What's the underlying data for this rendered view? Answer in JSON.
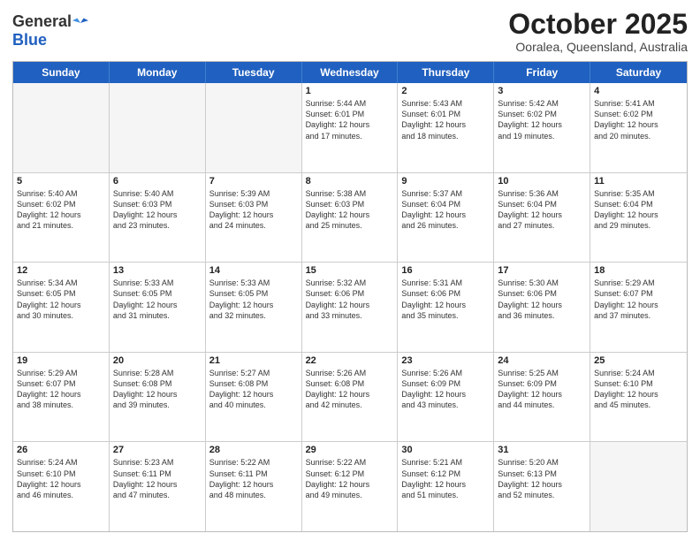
{
  "header": {
    "logo_line1": "General",
    "logo_line2": "Blue",
    "month_title": "October 2025",
    "subtitle": "Ooralea, Queensland, Australia"
  },
  "weekdays": [
    "Sunday",
    "Monday",
    "Tuesday",
    "Wednesday",
    "Thursday",
    "Friday",
    "Saturday"
  ],
  "rows": [
    [
      {
        "day": "",
        "info": ""
      },
      {
        "day": "",
        "info": ""
      },
      {
        "day": "",
        "info": ""
      },
      {
        "day": "1",
        "info": "Sunrise: 5:44 AM\nSunset: 6:01 PM\nDaylight: 12 hours\nand 17 minutes."
      },
      {
        "day": "2",
        "info": "Sunrise: 5:43 AM\nSunset: 6:01 PM\nDaylight: 12 hours\nand 18 minutes."
      },
      {
        "day": "3",
        "info": "Sunrise: 5:42 AM\nSunset: 6:02 PM\nDaylight: 12 hours\nand 19 minutes."
      },
      {
        "day": "4",
        "info": "Sunrise: 5:41 AM\nSunset: 6:02 PM\nDaylight: 12 hours\nand 20 minutes."
      }
    ],
    [
      {
        "day": "5",
        "info": "Sunrise: 5:40 AM\nSunset: 6:02 PM\nDaylight: 12 hours\nand 21 minutes."
      },
      {
        "day": "6",
        "info": "Sunrise: 5:40 AM\nSunset: 6:03 PM\nDaylight: 12 hours\nand 23 minutes."
      },
      {
        "day": "7",
        "info": "Sunrise: 5:39 AM\nSunset: 6:03 PM\nDaylight: 12 hours\nand 24 minutes."
      },
      {
        "day": "8",
        "info": "Sunrise: 5:38 AM\nSunset: 6:03 PM\nDaylight: 12 hours\nand 25 minutes."
      },
      {
        "day": "9",
        "info": "Sunrise: 5:37 AM\nSunset: 6:04 PM\nDaylight: 12 hours\nand 26 minutes."
      },
      {
        "day": "10",
        "info": "Sunrise: 5:36 AM\nSunset: 6:04 PM\nDaylight: 12 hours\nand 27 minutes."
      },
      {
        "day": "11",
        "info": "Sunrise: 5:35 AM\nSunset: 6:04 PM\nDaylight: 12 hours\nand 29 minutes."
      }
    ],
    [
      {
        "day": "12",
        "info": "Sunrise: 5:34 AM\nSunset: 6:05 PM\nDaylight: 12 hours\nand 30 minutes."
      },
      {
        "day": "13",
        "info": "Sunrise: 5:33 AM\nSunset: 6:05 PM\nDaylight: 12 hours\nand 31 minutes."
      },
      {
        "day": "14",
        "info": "Sunrise: 5:33 AM\nSunset: 6:05 PM\nDaylight: 12 hours\nand 32 minutes."
      },
      {
        "day": "15",
        "info": "Sunrise: 5:32 AM\nSunset: 6:06 PM\nDaylight: 12 hours\nand 33 minutes."
      },
      {
        "day": "16",
        "info": "Sunrise: 5:31 AM\nSunset: 6:06 PM\nDaylight: 12 hours\nand 35 minutes."
      },
      {
        "day": "17",
        "info": "Sunrise: 5:30 AM\nSunset: 6:06 PM\nDaylight: 12 hours\nand 36 minutes."
      },
      {
        "day": "18",
        "info": "Sunrise: 5:29 AM\nSunset: 6:07 PM\nDaylight: 12 hours\nand 37 minutes."
      }
    ],
    [
      {
        "day": "19",
        "info": "Sunrise: 5:29 AM\nSunset: 6:07 PM\nDaylight: 12 hours\nand 38 minutes."
      },
      {
        "day": "20",
        "info": "Sunrise: 5:28 AM\nSunset: 6:08 PM\nDaylight: 12 hours\nand 39 minutes."
      },
      {
        "day": "21",
        "info": "Sunrise: 5:27 AM\nSunset: 6:08 PM\nDaylight: 12 hours\nand 40 minutes."
      },
      {
        "day": "22",
        "info": "Sunrise: 5:26 AM\nSunset: 6:08 PM\nDaylight: 12 hours\nand 42 minutes."
      },
      {
        "day": "23",
        "info": "Sunrise: 5:26 AM\nSunset: 6:09 PM\nDaylight: 12 hours\nand 43 minutes."
      },
      {
        "day": "24",
        "info": "Sunrise: 5:25 AM\nSunset: 6:09 PM\nDaylight: 12 hours\nand 44 minutes."
      },
      {
        "day": "25",
        "info": "Sunrise: 5:24 AM\nSunset: 6:10 PM\nDaylight: 12 hours\nand 45 minutes."
      }
    ],
    [
      {
        "day": "26",
        "info": "Sunrise: 5:24 AM\nSunset: 6:10 PM\nDaylight: 12 hours\nand 46 minutes."
      },
      {
        "day": "27",
        "info": "Sunrise: 5:23 AM\nSunset: 6:11 PM\nDaylight: 12 hours\nand 47 minutes."
      },
      {
        "day": "28",
        "info": "Sunrise: 5:22 AM\nSunset: 6:11 PM\nDaylight: 12 hours\nand 48 minutes."
      },
      {
        "day": "29",
        "info": "Sunrise: 5:22 AM\nSunset: 6:12 PM\nDaylight: 12 hours\nand 49 minutes."
      },
      {
        "day": "30",
        "info": "Sunrise: 5:21 AM\nSunset: 6:12 PM\nDaylight: 12 hours\nand 51 minutes."
      },
      {
        "day": "31",
        "info": "Sunrise: 5:20 AM\nSunset: 6:13 PM\nDaylight: 12 hours\nand 52 minutes."
      },
      {
        "day": "",
        "info": ""
      }
    ]
  ]
}
